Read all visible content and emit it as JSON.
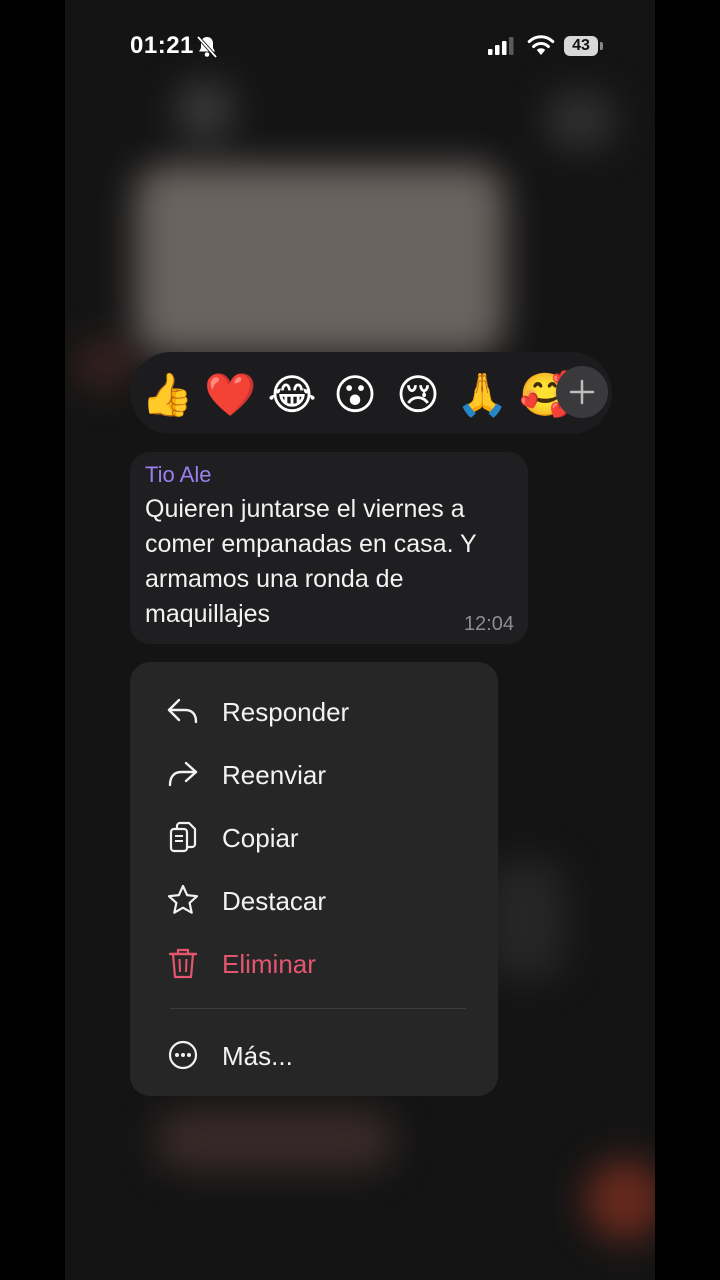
{
  "status_bar": {
    "time": "01:21",
    "battery": "43"
  },
  "reactions": {
    "emojis": [
      "👍",
      "❤️",
      "😂",
      "😮",
      "😢",
      "🙏",
      "🥰"
    ],
    "more_icon": "plus-icon"
  },
  "message": {
    "sender": "Tio Ale",
    "text": "Quieren juntarse el viernes a comer empanadas en casa. Y armamos una ronda de maquillajes",
    "time": "12:04",
    "sender_color": "#9a7ff0"
  },
  "menu": {
    "items": [
      {
        "label": "Responder",
        "icon": "reply-icon"
      },
      {
        "label": "Reenviar",
        "icon": "forward-icon"
      },
      {
        "label": "Copiar",
        "icon": "copy-icon"
      },
      {
        "label": "Destacar",
        "icon": "star-icon"
      },
      {
        "label": "Eliminar",
        "icon": "trash-icon",
        "color": "#e4566e"
      },
      {
        "label": "Más...",
        "icon": "more-icon"
      }
    ]
  }
}
